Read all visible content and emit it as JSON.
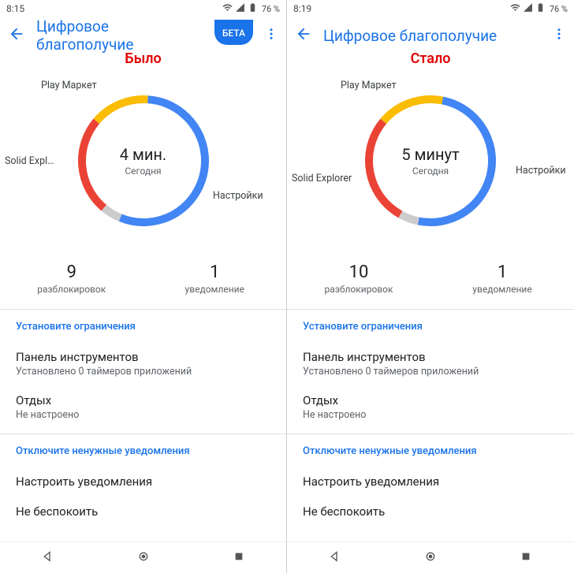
{
  "panes": [
    {
      "status": {
        "time": "8:15",
        "battery": "76 %"
      },
      "title": "Цифровое благополучие",
      "beta": "БЕТА",
      "overlay": "Было",
      "center": {
        "big": "4 мин.",
        "sub": "Сегодня"
      },
      "labels": {
        "top": "Play Маркет",
        "left": "Solid Expl…",
        "right": "Настройки"
      },
      "label_pos": {
        "top": {
          "l": 52,
          "t": 12
        },
        "left": {
          "l": 6,
          "t": 108
        },
        "right": {
          "l": 270,
          "t": 152
        }
      },
      "stats": [
        {
          "num": "9",
          "lbl": "разблокировок"
        },
        {
          "num": "1",
          "lbl": "уведомление"
        }
      ],
      "section1": {
        "title": "Установите ограничения",
        "items": [
          {
            "p": "Панель инструментов",
            "s": "Установлено 0 таймеров приложений"
          },
          {
            "p": "Отдых",
            "s": "Не настроено"
          }
        ]
      },
      "section2": {
        "title": "Отключите ненужные уведомления",
        "items": [
          {
            "p": "Настроить уведомления"
          },
          {
            "p": "Не беспокоить"
          }
        ]
      }
    },
    {
      "status": {
        "time": "8:19",
        "battery": "76 %"
      },
      "title": "Цифровое благополучие",
      "overlay": "Стало",
      "center": {
        "big": "5 минут",
        "sub": "Сегодня"
      },
      "labels": {
        "top": "Play Маркет",
        "left": "Solid Explorer",
        "right": "Настройки"
      },
      "label_pos": {
        "top": {
          "l": 68,
          "t": 12
        },
        "left": {
          "l": 6,
          "t": 130
        },
        "right": {
          "l": 290,
          "t": 120
        }
      },
      "stats": [
        {
          "num": "10",
          "lbl": "разблокировок"
        },
        {
          "num": "1",
          "lbl": "уведомление"
        }
      ],
      "section1": {
        "title": "Установите ограничения",
        "items": [
          {
            "p": "Панель инструментов",
            "s": "Установлено 0 таймеров приложений"
          },
          {
            "p": "Отдых",
            "s": "Не настроено"
          }
        ]
      },
      "section2": {
        "title": "Отключите ненужные уведомления",
        "items": [
          {
            "p": "Настроить уведомления"
          },
          {
            "p": "Не беспокоить"
          }
        ]
      }
    }
  ],
  "chart_data": [
    {
      "type": "pie",
      "title": "Screen time today",
      "series": [
        {
          "name": "Play Маркет",
          "value": 15,
          "color": "#fbbc04"
        },
        {
          "name": "Настройки",
          "value": 55,
          "color": "#4285f4"
        },
        {
          "name": "other",
          "value": 5,
          "color": "#cccccc"
        },
        {
          "name": "Solid Explorer",
          "value": 25,
          "color": "#ea4335"
        }
      ],
      "center_value": "4 мин.",
      "center_sub": "Сегодня"
    },
    {
      "type": "pie",
      "title": "Screen time today",
      "series": [
        {
          "name": "Play Маркет",
          "value": 17,
          "color": "#fbbc04"
        },
        {
          "name": "Настройки",
          "value": 50,
          "color": "#4285f4"
        },
        {
          "name": "other",
          "value": 5,
          "color": "#cccccc"
        },
        {
          "name": "Solid Explorer",
          "value": 28,
          "color": "#ea4335"
        }
      ],
      "center_value": "5 минут",
      "center_sub": "Сегодня"
    }
  ]
}
